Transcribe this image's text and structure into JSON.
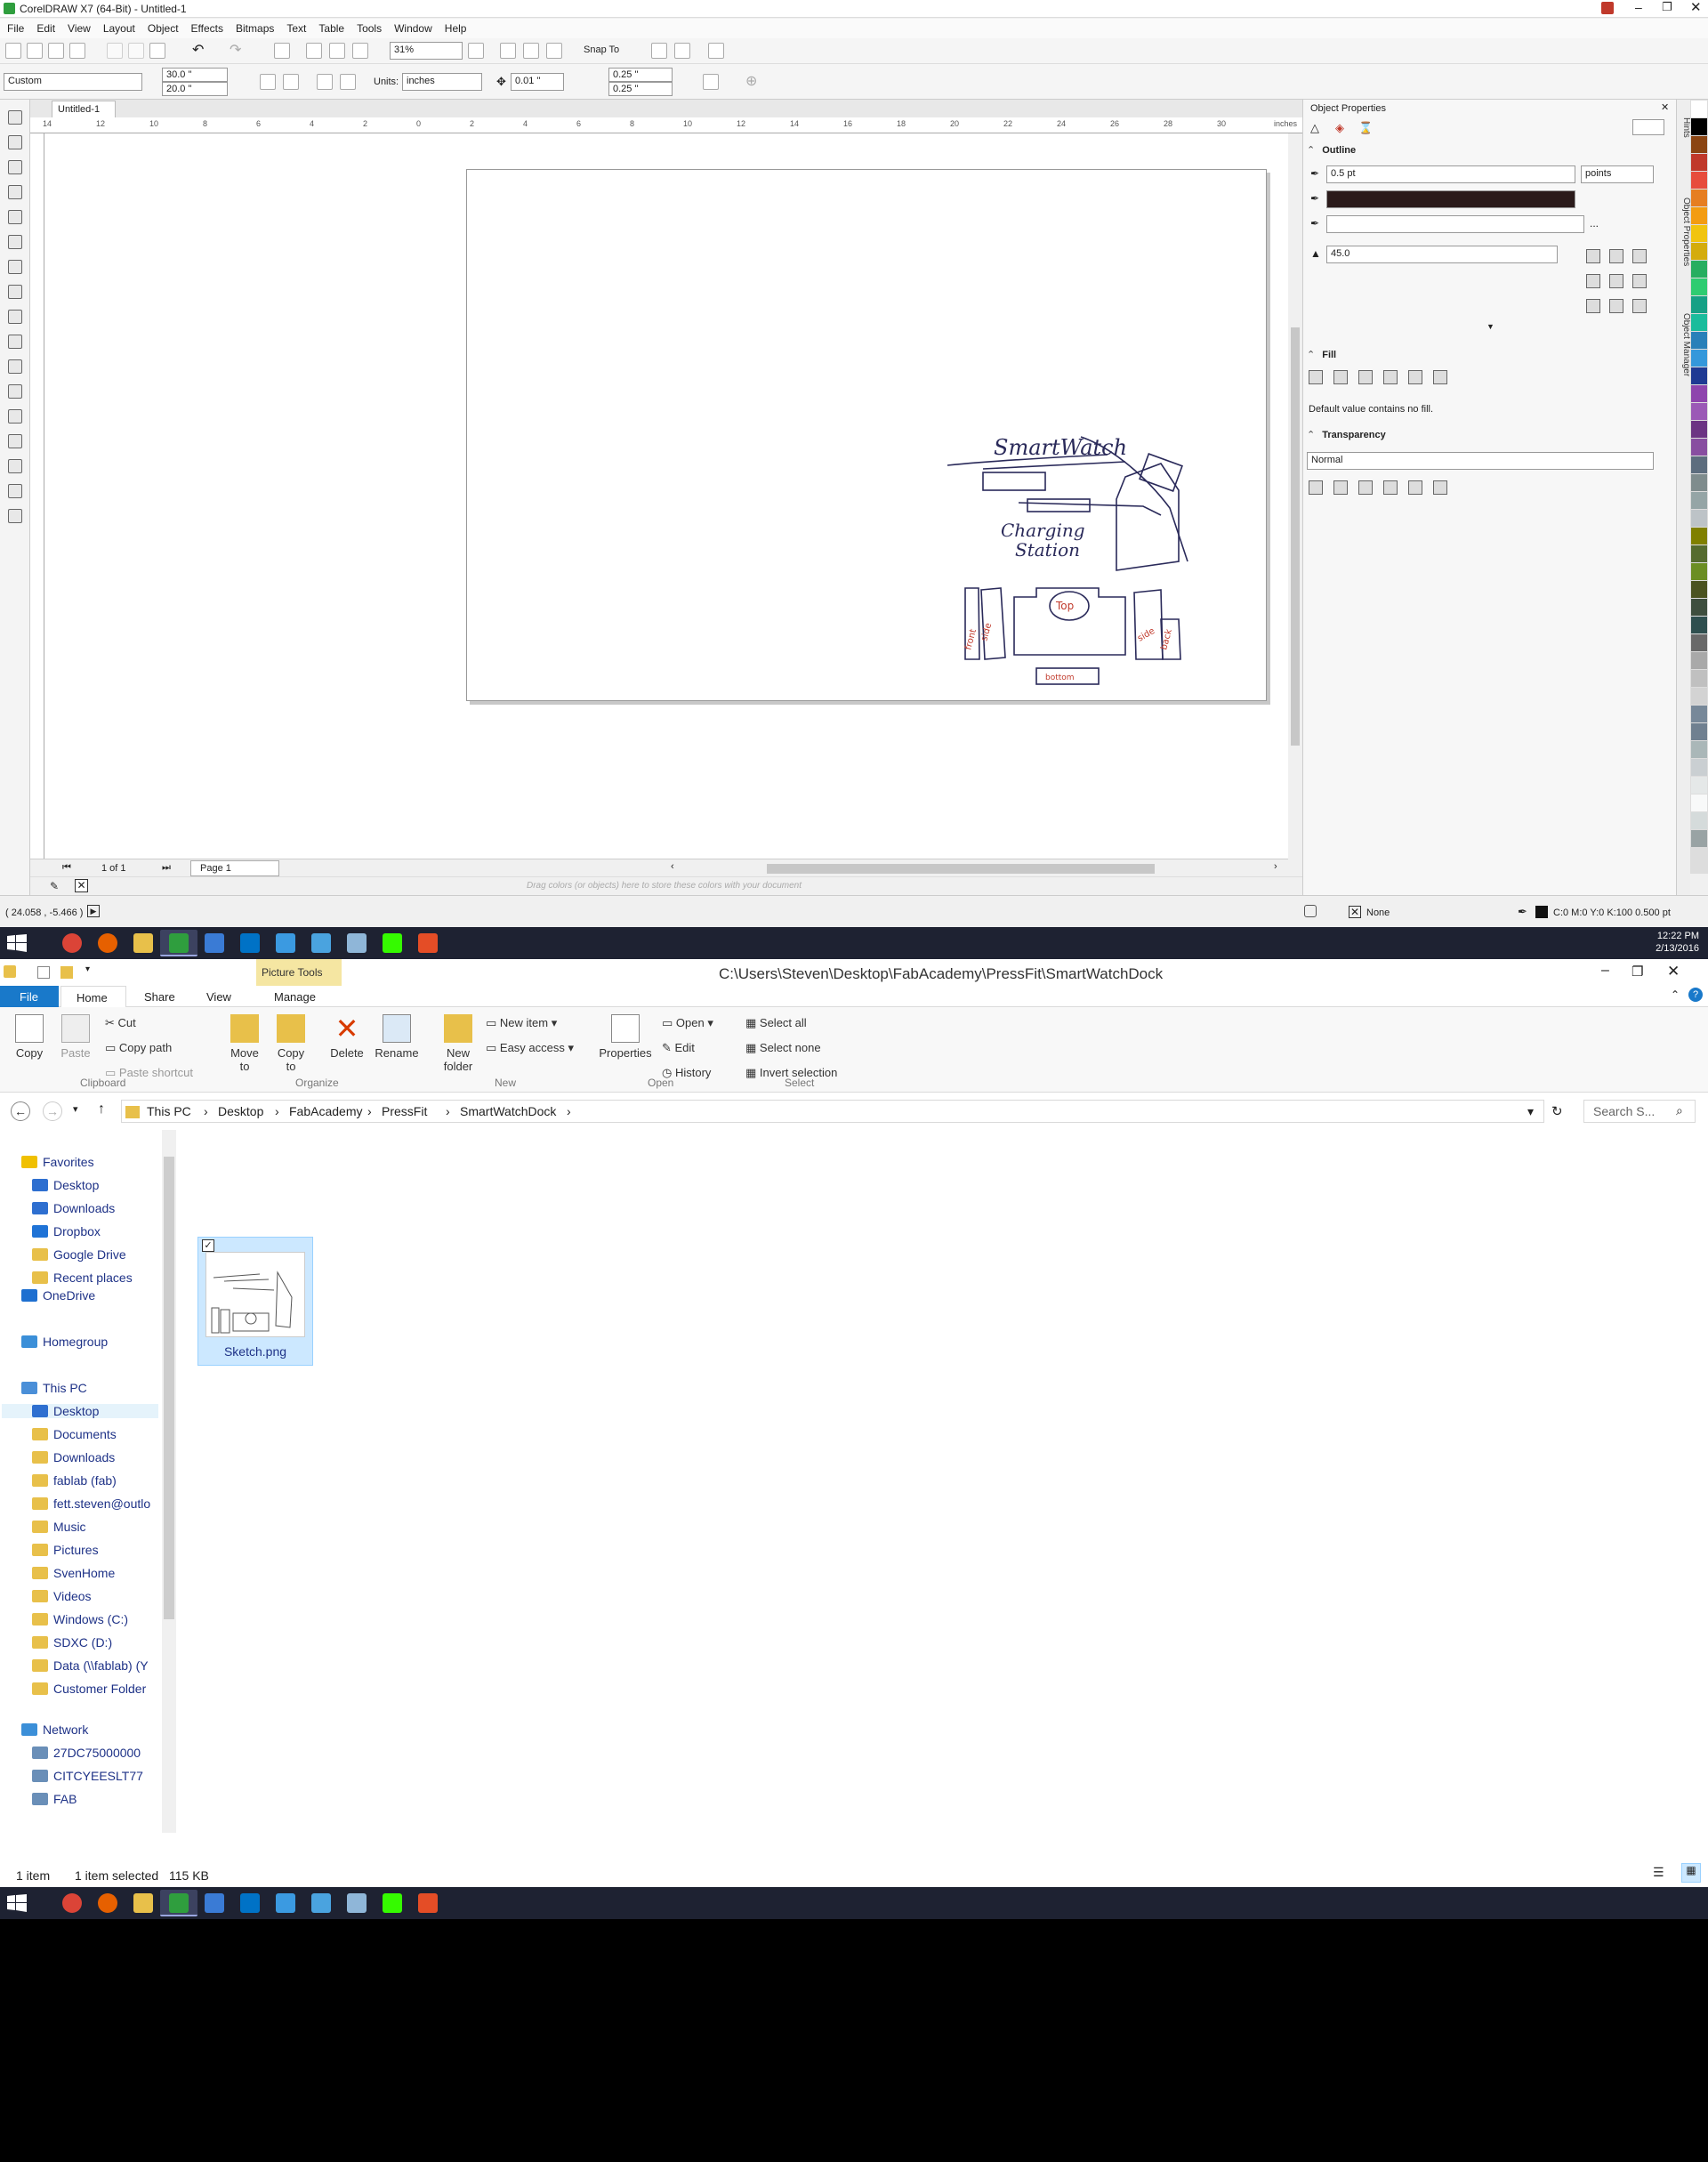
{
  "coreldraw": {
    "title": "CorelDRAW X7 (64-Bit) - Untitled-1",
    "menu": [
      "File",
      "Edit",
      "View",
      "Layout",
      "Object",
      "Effects",
      "Bitmaps",
      "Text",
      "Table",
      "Tools",
      "Window",
      "Help"
    ],
    "zoom": "31%",
    "snap_to": "Snap To",
    "page_preset": "Custom",
    "page_width": "30.0 \"",
    "page_height": "20.0 \"",
    "units_label": "Units:",
    "units": "inches",
    "nudge": "0.01 \"",
    "dup_x": "0.25 \"",
    "dup_y": "0.25 \"",
    "doc_tab": "Untitled-1",
    "ruler_unit": "inches",
    "ruler_ticks": [
      "14",
      "12",
      "10",
      "8",
      "6",
      "4",
      "2",
      "0",
      "2",
      "4",
      "6",
      "8",
      "10",
      "12",
      "14",
      "16",
      "18",
      "20",
      "22",
      "24",
      "26",
      "28",
      "30"
    ],
    "page_counter": "1 of 1",
    "page_tab": "Page 1",
    "palette_hint": "Drag colors (or objects) here to store these colors with your document",
    "cursor_pos": "( 24.058 , -5.466 )",
    "fill_status": "None",
    "outline_status": "C:0 M:0 Y:0 K:100  0.500 pt",
    "docker_title": "Object Properties",
    "outline_header": "Outline",
    "outline_width": "0.5 pt",
    "outline_units": "points",
    "outline_more": "...",
    "miter": "45.0",
    "fill_header": "Fill",
    "fill_default": "Default value contains no fill.",
    "transparency_header": "Transparency",
    "transparency_mode": "Normal",
    "side_tabs": [
      "Hints",
      "Object Properties",
      "Object Manager"
    ],
    "sketch_texts": {
      "smartwatch": "SmartWatch",
      "charging": "Charging",
      "station": "Station",
      "top": "Top",
      "bottom": "bottom",
      "side_left": "side",
      "side_right": "side",
      "front": "front",
      "back": "back"
    },
    "palette_colors": [
      "#ffffff",
      "#000000",
      "#8b4513",
      "#c0392b",
      "#e74c3c",
      "#e67e22",
      "#f39c12",
      "#f1c40f",
      "#d4ac0d",
      "#27ae60",
      "#2ecc71",
      "#16a085",
      "#1abc9c",
      "#2980b9",
      "#3498db",
      "#1f3a93",
      "#8e44ad",
      "#9b59b6",
      "#6c3483",
      "#884ea0",
      "#5d6d7e",
      "#7f8c8d",
      "#95a5a6",
      "#bdc3c7",
      "#808000",
      "#556b2f",
      "#6b8e23",
      "#4b5320",
      "#3e4e3e",
      "#2f4f4f",
      "#696969",
      "#a9a9a9",
      "#c0c0c0",
      "#d3d3d3",
      "#778899",
      "#708090",
      "#aab7b8",
      "#cacfd2",
      "#e5e8e8",
      "#f8f9f9",
      "#d5dbdb",
      "#99a3a4"
    ]
  },
  "taskbar": {
    "time": "12:22 PM",
    "date": "2/13/2016",
    "apps": [
      "chrome",
      "firefox",
      "file-explorer",
      "coreldraw",
      "remote-desktop",
      "outlook",
      "network",
      "settings",
      "clock",
      "dreamweaver",
      "brackets"
    ]
  },
  "explorer": {
    "picture_tools": "Picture Tools",
    "path_title": "C:\\Users\\Steven\\Desktop\\FabAcademy\\PressFit\\SmartWatchDock",
    "tabs": [
      "File",
      "Home",
      "Share",
      "View",
      "Manage"
    ],
    "clipboard": {
      "copy": "Copy",
      "paste": "Paste",
      "cut": "Cut",
      "copy_path": "Copy path",
      "paste_shortcut": "Paste shortcut",
      "group": "Clipboard"
    },
    "organize": {
      "move_to": "Move to",
      "copy_to": "Copy to",
      "delete": "Delete",
      "rename": "Rename",
      "group": "Organize"
    },
    "new": {
      "new_folder": "New folder",
      "new_item": "New item",
      "easy_access": "Easy access",
      "group": "New"
    },
    "open": {
      "properties": "Properties",
      "open": "Open",
      "edit": "Edit",
      "history": "History",
      "group": "Open"
    },
    "select": {
      "select_all": "Select all",
      "select_none": "Select none",
      "invert": "Invert selection",
      "group": "Select"
    },
    "breadcrumb": [
      "This PC",
      "Desktop",
      "FabAcademy",
      "PressFit",
      "SmartWatchDock"
    ],
    "search_placeholder": "Search S...",
    "nav": {
      "favorites": "Favorites",
      "fav_items": [
        "Desktop",
        "Downloads",
        "Dropbox",
        "Google Drive",
        "Recent places"
      ],
      "onedrive": "OneDrive",
      "homegroup": "Homegroup",
      "thispc": "This PC",
      "pc_items": [
        "Desktop",
        "Documents",
        "Downloads",
        "fablab (fab)",
        "fett.steven@outlo",
        "Music",
        "Pictures",
        "SvenHome",
        "Videos",
        "Windows (C:)",
        "SDXC (D:)",
        "Data (\\\\fablab) (Y",
        "Customer Folder"
      ],
      "network": "Network",
      "net_items": [
        "27DC75000000",
        "CITCYEESLT77",
        "FAB"
      ]
    },
    "file": {
      "name": "Sketch.png"
    },
    "status": {
      "count": "1 item",
      "selected": "1 item selected",
      "size": "115 KB"
    }
  }
}
